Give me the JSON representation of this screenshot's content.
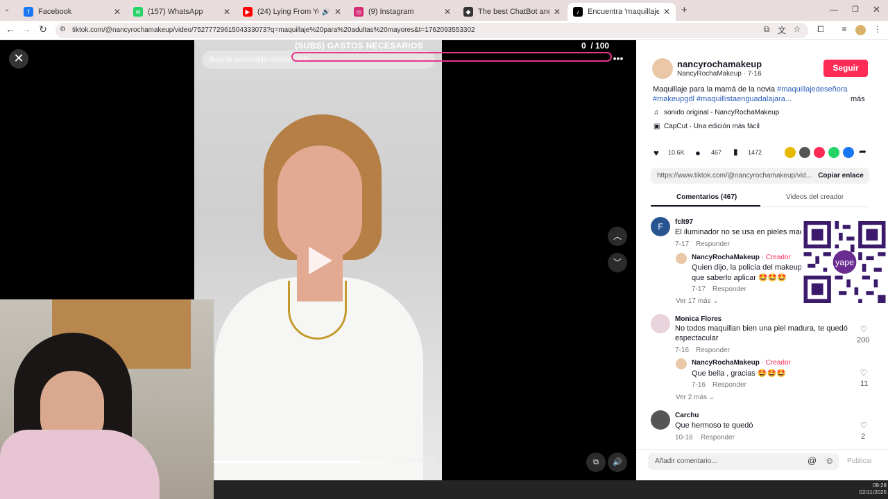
{
  "browser": {
    "tabs": [
      {
        "title": "Facebook",
        "favicon_color": "#1877f2",
        "glyph": "f"
      },
      {
        "title": "(157) WhatsApp",
        "favicon_color": "#25d366",
        "glyph": "w"
      },
      {
        "title": "(24) Lying From You - Linkin",
        "favicon_color": "#ff0000",
        "glyph": "▶"
      },
      {
        "title": "(9) Instagram",
        "favicon_color": "#d62976",
        "glyph": "◎"
      },
      {
        "title": "The best ChatBot and Widget",
        "favicon_color": "#333333",
        "glyph": "◆"
      },
      {
        "title": "Encuentra 'maquillaje para adu",
        "favicon_color": "#000000",
        "glyph": "♪"
      }
    ],
    "new_tab": "+",
    "url": "tiktok.com/@nancyrochamakeup/video/7527772961504333073?q=maquillaje%20para%20adultas%20mayores&t=1762093553302"
  },
  "player": {
    "overlay_title": "(SUBS) GASTOS NECESARIOS",
    "counter": "0",
    "counter_total": "/ 100",
    "search_placeholder": "Buscar contenido relacionado",
    "time": "01:46/02:06",
    "progress": 0.84
  },
  "creator": {
    "username": "nancyrochamakeup",
    "subline": "NancyRochaMakeup · 7-16",
    "follow": "Seguir",
    "caption_text": "Maquillaje para la mamá de la novia ",
    "caption_tag1": "#maquillajedeseñora",
    "caption_tag2": "#makeupgdl",
    "caption_tag3": "#maquillistaenguadalajara...",
    "more": "más",
    "sound": "sonido original - NancyRochaMakeup",
    "capcut": "CapCut · Una edición más fácil",
    "likes": "10.6K",
    "comments": "467",
    "saves": "1472",
    "link": "https://www.tiktok.com/@nancyrochamakeup/vid...",
    "copy": "Copiar enlace"
  },
  "tabs": {
    "comments": "Comentarios (467)",
    "creator_videos": "Videos del creador"
  },
  "comments": [
    {
      "user": "fclt97",
      "text": "El iluminador no se usa en pieles madu",
      "date": "7-17",
      "reply": "Responder",
      "avatar": "F",
      "likes": ""
    },
    {
      "user": "NancyRochaMakeup",
      "badge": "· Creador",
      "text1": "Quien dijo, la policía del makeup",
      "text2": "que saberlo aplicar 🤩🤩🤩",
      "date": "7-17",
      "reply": "Responder"
    },
    {
      "more": "Ver 17 más"
    },
    {
      "user": "Monica Flores",
      "text1": "No todos maquillan bien una piel madura, te quedó",
      "text2": "espectacular",
      "date": "7-16",
      "reply": "Responder",
      "likes": "200"
    },
    {
      "user": "NancyRochaMakeup",
      "badge": "· Creador",
      "text": "Que bella , gracias 🤩🤩🤩",
      "date": "7-16",
      "reply": "Responder",
      "likes": "11"
    },
    {
      "more": "Ver 2 más"
    },
    {
      "user": "Carchu",
      "text": "Que hermoso te quedó",
      "date": "10-16",
      "reply": "Responder",
      "likes": "2"
    }
  ],
  "comment_bar": {
    "placeholder": "Añadir comentario...",
    "publish": "Publicar"
  },
  "qr": {
    "label": "yape"
  },
  "clock": {
    "time": "09:28",
    "date": "02/11/2025"
  },
  "colors": {
    "accent": "#fe2c55",
    "link": "#2b5db9",
    "tab_bg": "#e8dcdc"
  }
}
